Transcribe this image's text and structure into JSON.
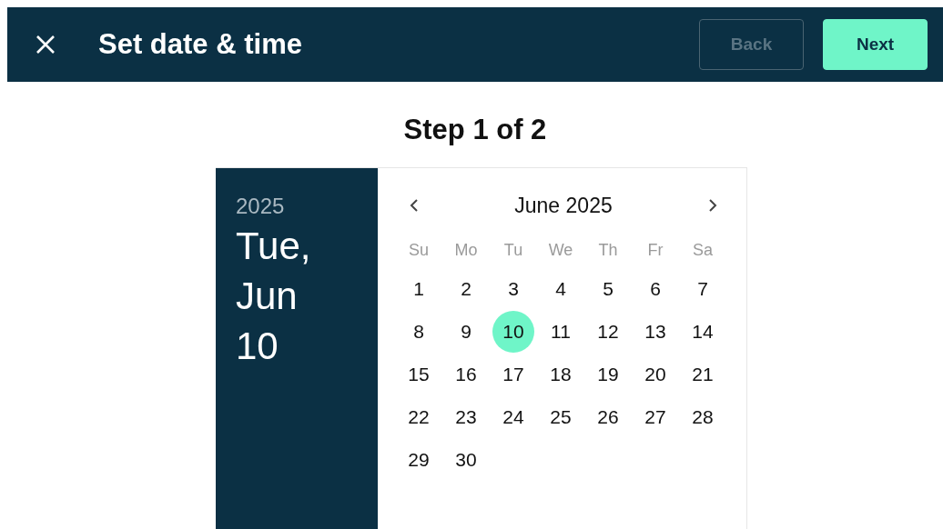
{
  "header": {
    "title": "Set date & time"
  },
  "buttons": [
    {
      "kind": "back",
      "label": "Back",
      "disabled": true
    },
    {
      "kind": "next",
      "label": "Next",
      "disabled": false
    }
  ],
  "step": "Step 1 of 2",
  "date_picker": {
    "year": "2025",
    "selected_date": "Tue, Jun 10",
    "month_label": "June 2025",
    "weekdays": [
      "Su",
      "Mo",
      "Tu",
      "We",
      "Th",
      "Fr",
      "Sa"
    ],
    "days": [
      {
        "label": "1",
        "selected": false
      },
      {
        "label": "2",
        "selected": false
      },
      {
        "label": "3",
        "selected": false
      },
      {
        "label": "4",
        "selected": false
      },
      {
        "label": "5",
        "selected": false
      },
      {
        "label": "6",
        "selected": false
      },
      {
        "label": "7",
        "selected": false
      },
      {
        "label": "8",
        "selected": false
      },
      {
        "label": "9",
        "selected": false
      },
      {
        "label": "10",
        "selected": true
      },
      {
        "label": "11",
        "selected": false
      },
      {
        "label": "12",
        "selected": false
      },
      {
        "label": "13",
        "selected": false
      },
      {
        "label": "14",
        "selected": false
      },
      {
        "label": "15",
        "selected": false
      },
      {
        "label": "16",
        "selected": false
      },
      {
        "label": "17",
        "selected": false
      },
      {
        "label": "18",
        "selected": false
      },
      {
        "label": "19",
        "selected": false
      },
      {
        "label": "20",
        "selected": false
      },
      {
        "label": "21",
        "selected": false
      },
      {
        "label": "22",
        "selected": false
      },
      {
        "label": "23",
        "selected": false
      },
      {
        "label": "24",
        "selected": false
      },
      {
        "label": "25",
        "selected": false
      },
      {
        "label": "26",
        "selected": false
      },
      {
        "label": "27",
        "selected": false
      },
      {
        "label": "28",
        "selected": false
      },
      {
        "label": "29",
        "selected": false
      },
      {
        "label": "30",
        "selected": false
      }
    ]
  }
}
